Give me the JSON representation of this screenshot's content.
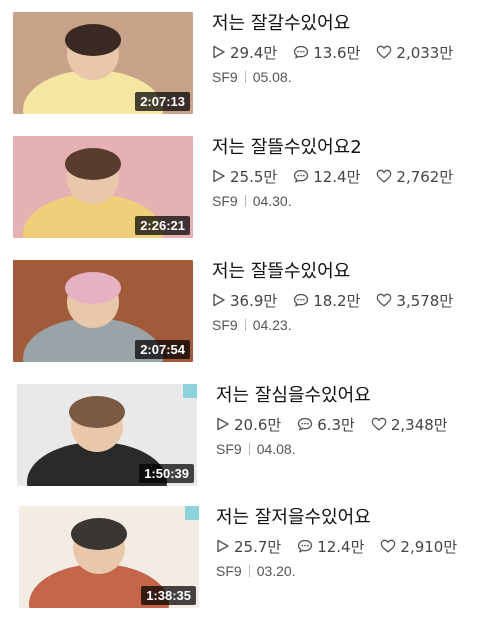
{
  "videos": [
    {
      "title": "저는 잘갈수있어요",
      "plays": "29.4만",
      "comments": "13.6만",
      "likes": "2,033만",
      "channel": "SF9",
      "date": "05.08.",
      "duration": "2:07:13",
      "thumb_colors": [
        "#c9a389",
        "#f5e7a2",
        "#3b2a23"
      ],
      "has_badge": false
    },
    {
      "title": "저는 잘뜰수있어요2",
      "plays": "25.5만",
      "comments": "12.4만",
      "likes": "2,762만",
      "channel": "SF9",
      "date": "04.30.",
      "duration": "2:26:21",
      "thumb_colors": [
        "#e6b1b3",
        "#f0cf7a",
        "#5a3c2e"
      ],
      "has_badge": false
    },
    {
      "title": "저는 잘뜰수있어요",
      "plays": "36.9만",
      "comments": "18.2만",
      "likes": "3,578만",
      "channel": "SF9",
      "date": "04.23.",
      "duration": "2:07:54",
      "thumb_colors": [
        "#a15a3a",
        "#9aa3a8",
        "#e7b1c4"
      ],
      "has_badge": false
    },
    {
      "title": "저는 잘심을수있어요",
      "plays": "20.6만",
      "comments": "6.3만",
      "likes": "2,348만",
      "channel": "SF9",
      "date": "04.08.",
      "duration": "1:50:39",
      "thumb_colors": [
        "#e9e9ea",
        "#2a2a2a",
        "#7b5a44"
      ],
      "has_badge": true
    },
    {
      "title": "저는 잘저을수있어요",
      "plays": "25.7만",
      "comments": "12.4만",
      "likes": "2,910만",
      "channel": "SF9",
      "date": "03.20.",
      "duration": "1:38:35",
      "thumb_colors": [
        "#f2ece4",
        "#c5654a",
        "#3a3632"
      ],
      "has_badge": true
    }
  ]
}
